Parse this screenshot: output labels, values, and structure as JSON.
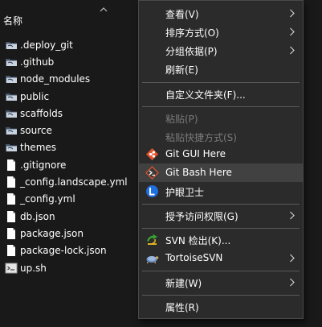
{
  "explorer": {
    "column_header": "名称",
    "files": [
      {
        "name": ".deploy_git",
        "icon": "folder-icon"
      },
      {
        "name": ".github",
        "icon": "folder-icon"
      },
      {
        "name": "node_modules",
        "icon": "folder-icon"
      },
      {
        "name": "public",
        "icon": "folder-icon"
      },
      {
        "name": "scaffolds",
        "icon": "folder-icon"
      },
      {
        "name": "source",
        "icon": "folder-icon"
      },
      {
        "name": "themes",
        "icon": "folder-icon"
      },
      {
        "name": ".gitignore",
        "icon": "file-icon"
      },
      {
        "name": "_config.landscape.yml",
        "icon": "file-icon"
      },
      {
        "name": "_config.yml",
        "icon": "file-icon"
      },
      {
        "name": "db.json",
        "icon": "file-icon"
      },
      {
        "name": "package.json",
        "icon": "file-icon"
      },
      {
        "name": "package-lock.json",
        "icon": "file-icon"
      },
      {
        "name": "up.sh",
        "icon": "shell-script-icon"
      }
    ]
  },
  "context_menu": {
    "items": [
      {
        "label": "查看(V)",
        "submenu": true
      },
      {
        "label": "排序方式(O)",
        "submenu": true
      },
      {
        "label": "分组依据(P)",
        "submenu": true
      },
      {
        "label": "刷新(E)"
      },
      {
        "label": "自定义文件夹(F)..."
      },
      {
        "label": "粘贴(P)",
        "disabled": true
      },
      {
        "label": "粘贴快捷方式(S)",
        "disabled": true
      },
      {
        "label": "Git GUI Here",
        "icon": "git-gui-icon"
      },
      {
        "label": "Git Bash Here",
        "icon": "git-bash-icon",
        "highlighted": true
      },
      {
        "label": "护眼卫士",
        "icon": "eye-guard-icon"
      },
      {
        "label": "授予访问权限(G)",
        "submenu": true
      },
      {
        "label": "SVN 检出(K)...",
        "icon": "svn-checkout-icon"
      },
      {
        "label": "TortoiseSVN",
        "icon": "tortoisesvn-icon",
        "submenu": true
      },
      {
        "label": "新建(W)",
        "submenu": true
      },
      {
        "label": "属性(R)"
      }
    ]
  },
  "colors": {
    "background": "#191919",
    "menu_background": "#2b2b2b",
    "menu_highlight": "#414141",
    "disabled_text": "#7a7a7a"
  }
}
